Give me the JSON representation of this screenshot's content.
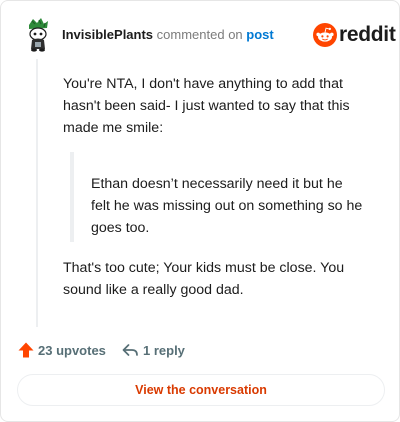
{
  "header": {
    "username": "InvisiblePlants",
    "action_text": "commented on",
    "target_link": "post",
    "brand_wordmark": "reddit"
  },
  "comment": {
    "paragraph1": "You're NTA, I don't have anything to add that hasn't been said- I just wanted to say that this made me smile:",
    "quote": "Ethan doesn’t necessarily need it but he felt he was missing out on something so he goes too.",
    "paragraph2": "That's too cute; Your kids must be close. You sound like a really good dad."
  },
  "footer": {
    "upvotes": "23 upvotes",
    "replies": "1 reply",
    "view_button": "View the conversation"
  },
  "colors": {
    "brand_orange": "#ff4500",
    "link_blue": "#0079d3",
    "button_text": "#d93a00",
    "meta_gray": "#576f76"
  },
  "icons": {
    "avatar": "snoo-avatar-icon",
    "logo": "reddit-logo-icon",
    "upvote": "upvote-arrow-icon",
    "reply": "reply-arrow-icon"
  }
}
